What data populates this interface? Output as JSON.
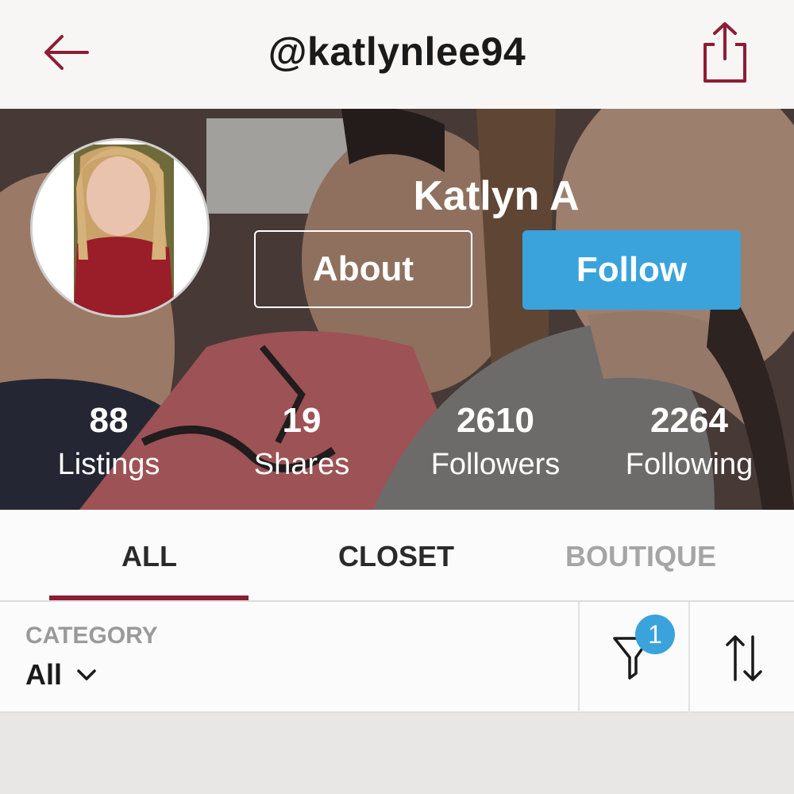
{
  "header": {
    "username": "@katlynlee94"
  },
  "profile": {
    "display_name": "Katlyn A",
    "about_label": "About",
    "follow_label": "Follow",
    "stats": [
      {
        "value": "88",
        "label": "Listings"
      },
      {
        "value": "19",
        "label": "Shares"
      },
      {
        "value": "2610",
        "label": "Followers"
      },
      {
        "value": "2264",
        "label": "Following"
      }
    ]
  },
  "tabs": [
    {
      "label": "ALL",
      "selected": true
    },
    {
      "label": "CLOSET",
      "selected": false
    },
    {
      "label": "BOUTIQUE",
      "selected": false
    }
  ],
  "filter": {
    "category_label": "CATEGORY",
    "category_value": "All",
    "filter_badge": "1"
  },
  "icons": [
    "back-arrow-icon",
    "share-icon",
    "chevron-down-icon",
    "filter-funnel-icon",
    "sort-icon"
  ],
  "colors": {
    "accent": "#8c1d34",
    "follow_blue": "#3aa3dc",
    "badge_blue": "#3aa3dc"
  }
}
